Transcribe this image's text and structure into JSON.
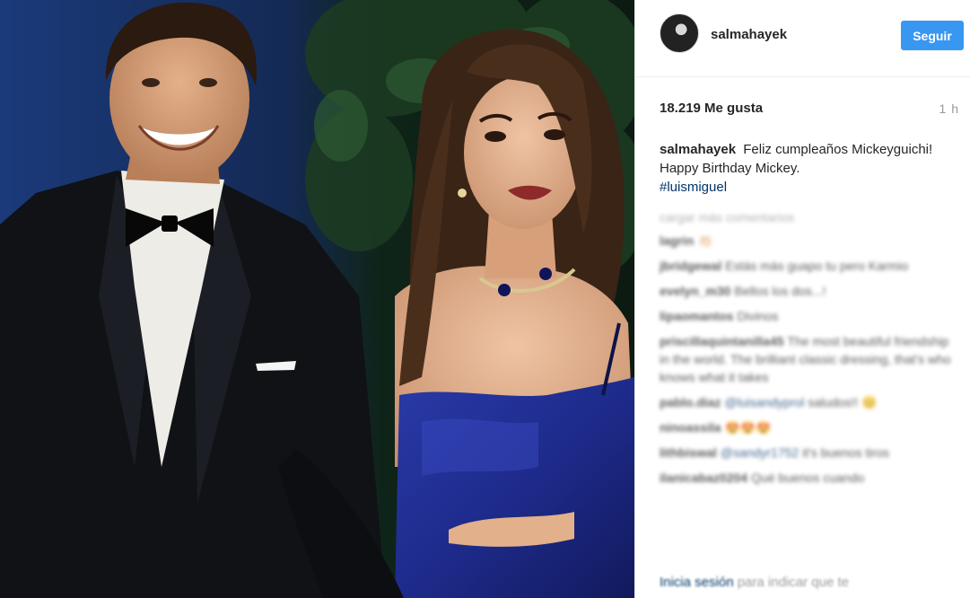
{
  "header": {
    "username": "salmahayek",
    "follow_label": "Seguir"
  },
  "post": {
    "likes": "18.219 Me gusta",
    "time_ago": "1 h"
  },
  "caption": {
    "username": "salmahayek",
    "text": "Feliz cumpleaños Mickeyguichi! Happy Birthday Mickey.",
    "hashtag": "#luismiguel"
  },
  "comments": {
    "load_more": "cargar más comentarios",
    "items": [
      {
        "user": "lagrin",
        "text": "👏🏻"
      },
      {
        "user": "jbridgewal",
        "text": "Estás más guapo tu pero Karmio"
      },
      {
        "user": "evelyn_m30",
        "text": "Bellos los dos...!"
      },
      {
        "user": "lipaomantos",
        "text": "Divinos"
      },
      {
        "user": "priscillaquintanilla45",
        "text": "The most beautiful friendship in the world. The brilliant classic dressing, that's who knows what it takes"
      },
      {
        "user": "pablo.diaz",
        "mention": "@luisandyprol",
        "text": "saludos!! 😊"
      },
      {
        "user": "ninoassila",
        "text": "😍😍😍"
      },
      {
        "user": "lithbiswal",
        "mention": "@sandyr1752",
        "text": "it's buenos tiros"
      },
      {
        "user": "ilanicabaz0204",
        "text": "Qué buenos cuando"
      }
    ]
  },
  "footer": {
    "login_link": "Inicia sesión",
    "login_text": "para indicar que te"
  },
  "colors": {
    "follow_button": "#3897f0",
    "hashtag_link": "#003569",
    "muted_text": "#999999"
  }
}
